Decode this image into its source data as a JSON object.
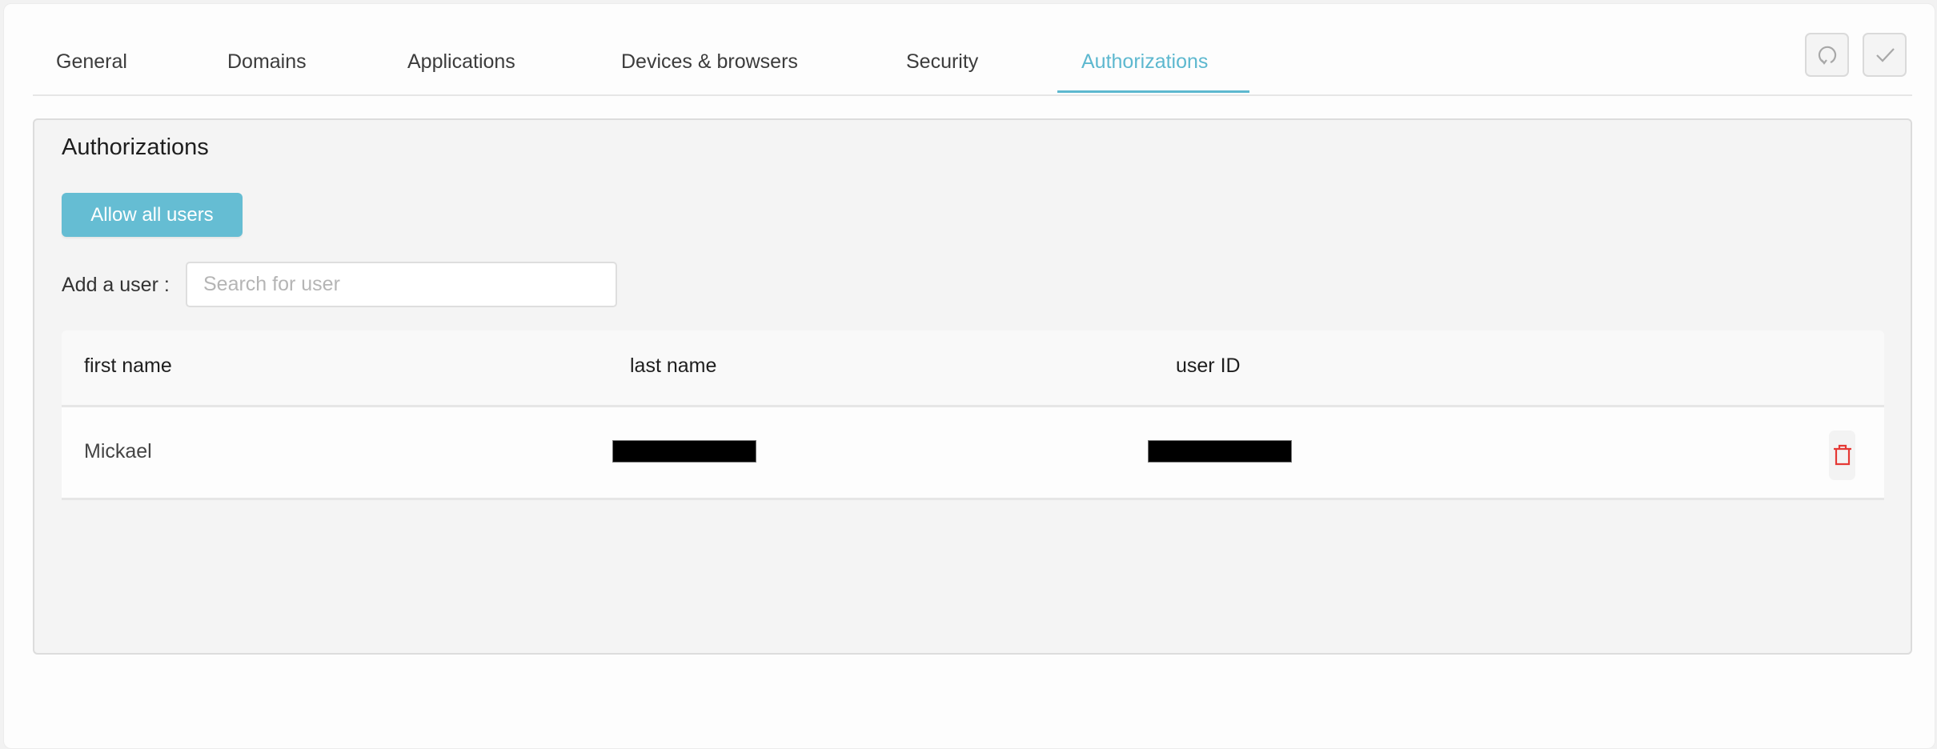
{
  "tabs": [
    {
      "label": "General",
      "active": false
    },
    {
      "label": "Domains",
      "active": false
    },
    {
      "label": "Applications",
      "active": false
    },
    {
      "label": "Devices & browsers",
      "active": false
    },
    {
      "label": "Security",
      "active": false
    },
    {
      "label": "Authorizations",
      "active": true
    }
  ],
  "toolbar": {
    "undo_icon": "undo-icon",
    "save_icon": "check-icon"
  },
  "panel": {
    "title": "Authorizations",
    "allow_all_label": "Allow all users",
    "add_user_label": "Add a user :",
    "search": {
      "placeholder": "Search for user",
      "value": ""
    }
  },
  "table": {
    "columns": [
      "first name",
      "last name",
      "user ID"
    ],
    "rows": [
      {
        "first_name": "Mickael",
        "last_name": "[redacted]",
        "user_id": "[redacted]",
        "action_icon": "trash-icon"
      }
    ]
  },
  "colors": {
    "accent": "#5db8cf",
    "button": "#65bdd3",
    "danger": "#e53935"
  }
}
